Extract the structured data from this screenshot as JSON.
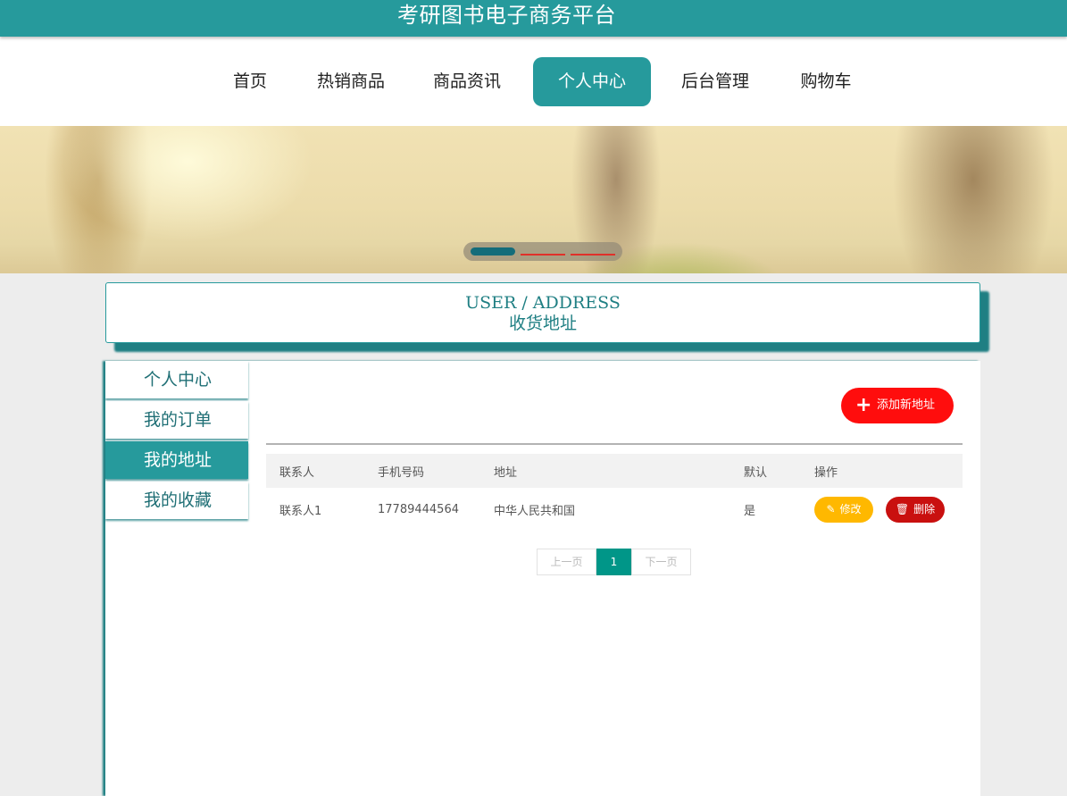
{
  "site": {
    "title": "考研图书电子商务平台"
  },
  "nav": {
    "items": [
      {
        "label": "首页"
      },
      {
        "label": "热销商品"
      },
      {
        "label": "商品资讯"
      },
      {
        "label": "个人中心"
      },
      {
        "label": "后台管理"
      },
      {
        "label": "购物车"
      }
    ],
    "active": "个人中心"
  },
  "banner": {
    "slide_count": 3,
    "active_slide": 1
  },
  "heading": {
    "en": "USER / ADDRESS",
    "cn": "收货地址"
  },
  "sidebar": {
    "items": [
      {
        "label": "个人中心"
      },
      {
        "label": "我的订单"
      },
      {
        "label": "我的地址"
      },
      {
        "label": "我的收藏"
      }
    ],
    "active": "我的地址"
  },
  "toolbar": {
    "add_label": "添加新地址",
    "add_icon": "plus-icon"
  },
  "table": {
    "columns": [
      "联系人",
      "手机号码",
      "地址",
      "默认",
      "操作"
    ],
    "rows": [
      {
        "contact": "联系人1",
        "phone": "17789444564",
        "address": "中华人民共和国",
        "default": "是",
        "edit_label": "修改",
        "delete_label": "删除"
      }
    ]
  },
  "pagination": {
    "prev": "上一页",
    "current": "1",
    "next": "下一页"
  },
  "colors": {
    "primary": "#269a9c",
    "danger": "#ff0d0d",
    "warning": "#ffb800",
    "delete": "#c9100f",
    "pager_active": "#009688"
  }
}
